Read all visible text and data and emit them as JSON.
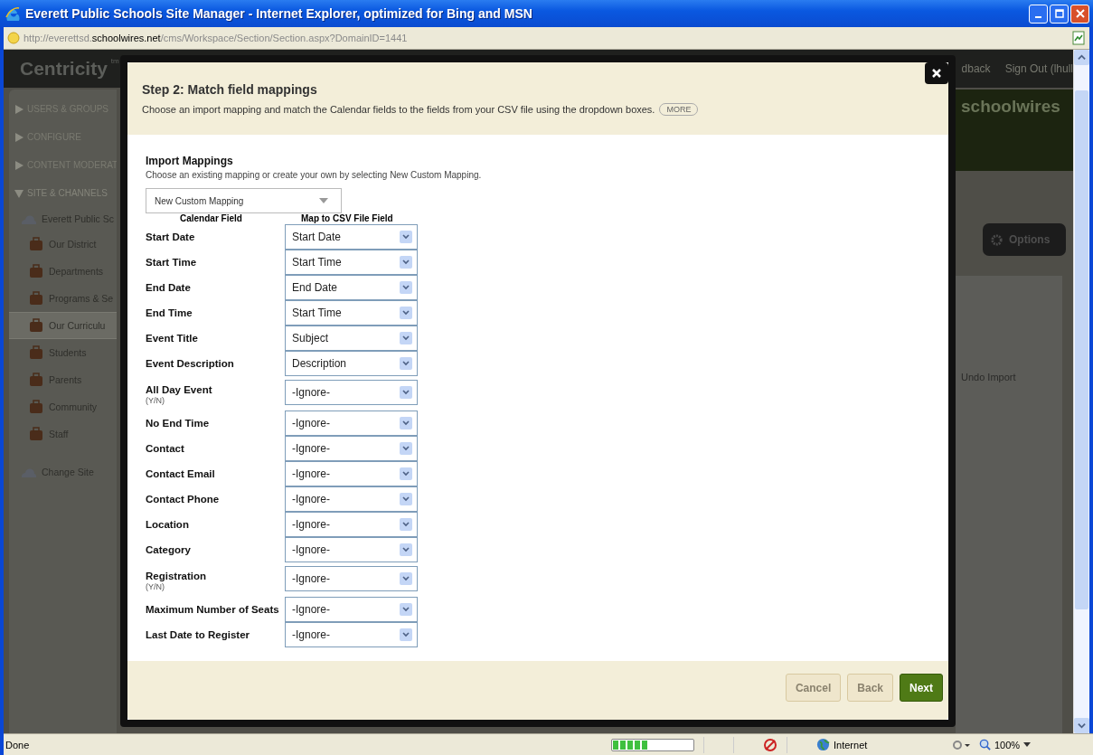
{
  "window": {
    "title": "Everett Public Schools Site Manager - Internet Explorer, optimized for Bing and MSN"
  },
  "address_bar": {
    "url": [
      {
        "text": "http://everettsd.",
        "highlighted": false
      },
      {
        "text": "schoolwires.net",
        "highlighted": true
      },
      {
        "text": "/cms/Workspace/Section/Section.aspx?DomainID=1441",
        "highlighted": false
      }
    ]
  },
  "background_page": {
    "logo": "Centricity",
    "logo_mark": "tm",
    "header_links": [
      "dback",
      "Sign Out (lhull"
    ],
    "brand": "schoolwires",
    "sidebar": {
      "sections": [
        {
          "label": "USERS & GROUPS",
          "expanded": false
        },
        {
          "label": "CONFIGURE",
          "expanded": false
        },
        {
          "label": "CONTENT MODERAT",
          "expanded": false
        },
        {
          "label": "SITE & CHANNELS",
          "expanded": true
        }
      ],
      "site": "Everett Public Sc",
      "channels": [
        {
          "label": "Our District",
          "selected": false
        },
        {
          "label": "Departments",
          "selected": false
        },
        {
          "label": "Programs & Se",
          "selected": false
        },
        {
          "label": "Our Curriculu",
          "selected": true
        },
        {
          "label": "Students",
          "selected": false
        },
        {
          "label": "Parents",
          "selected": false
        },
        {
          "label": "Community",
          "selected": false
        },
        {
          "label": "Staff",
          "selected": false
        }
      ],
      "change_site": "Change Site"
    },
    "options_button": "Options",
    "undo_import": "Undo Import"
  },
  "dialog": {
    "title": "Step 2: Match field mappings",
    "description": "Choose an import mapping and match the Calendar fields to the fields from your CSV file using the dropdown boxes.",
    "more_button": "MORE",
    "import_mappings": {
      "heading": "Import Mappings",
      "hint": "Choose an existing mapping or create your own by selecting New Custom Mapping.",
      "value": "New Custom Mapping"
    },
    "columns": [
      "Calendar Field",
      "Map to CSV File Field"
    ],
    "rows": [
      {
        "label": "Start Date",
        "value": "Start Date"
      },
      {
        "label": "Start Time",
        "value": "Start Time"
      },
      {
        "label": "End Date",
        "value": "End Date"
      },
      {
        "label": "End Time",
        "value": "Start Time"
      },
      {
        "label": "Event Title",
        "value": "Subject"
      },
      {
        "label": "Event Description",
        "value": "Description"
      },
      {
        "label": "All Day Event",
        "note": "(Y/N)",
        "value": "-Ignore-"
      },
      {
        "label": "No End Time",
        "value": "-Ignore-"
      },
      {
        "label": "Contact",
        "value": "-Ignore-"
      },
      {
        "label": "Contact Email",
        "value": "-Ignore-"
      },
      {
        "label": "Contact Phone",
        "value": "-Ignore-"
      },
      {
        "label": "Location",
        "value": "-Ignore-"
      },
      {
        "label": "Category",
        "value": "-Ignore-"
      },
      {
        "label": "Registration",
        "note": "(Y/N)",
        "value": "-Ignore-"
      },
      {
        "label": "Maximum Number of Seats",
        "value": "-Ignore-"
      },
      {
        "label": "Last Date to Register",
        "value": "-Ignore-"
      }
    ],
    "buttons": [
      {
        "label": "Cancel",
        "kind": "secondary"
      },
      {
        "label": "Back",
        "kind": "secondary"
      },
      {
        "label": "Next",
        "kind": "primary"
      }
    ]
  },
  "status_bar": {
    "status": "Done",
    "progress": {
      "level": 0.45
    },
    "zone": "Internet",
    "zoom": "100%"
  }
}
